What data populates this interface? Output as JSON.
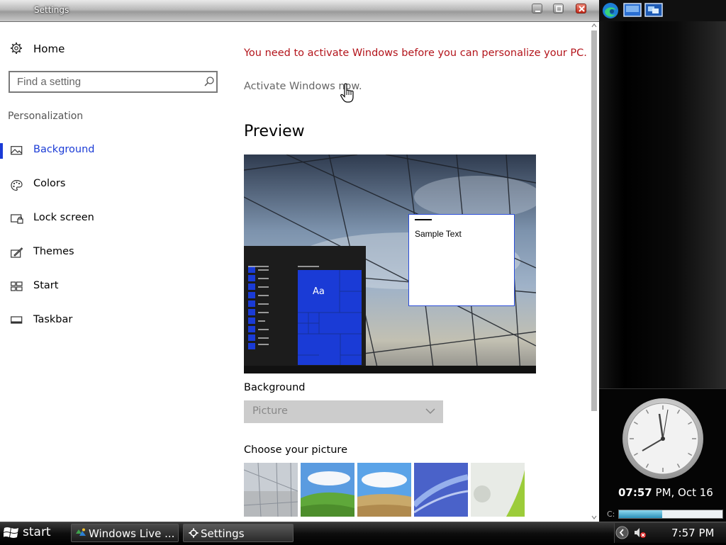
{
  "window": {
    "title": "Settings"
  },
  "nav": {
    "home_label": "Home",
    "search_placeholder": "Find a setting",
    "section_label": "Personalization",
    "items": [
      {
        "label": "Background",
        "icon": "picture-icon",
        "selected": true
      },
      {
        "label": "Colors",
        "icon": "palette-icon",
        "selected": false
      },
      {
        "label": "Lock screen",
        "icon": "lock-screen-icon",
        "selected": false
      },
      {
        "label": "Themes",
        "icon": "brush-icon",
        "selected": false
      },
      {
        "label": "Start",
        "icon": "start-grid-icon",
        "selected": false
      },
      {
        "label": "Taskbar",
        "icon": "taskbar-icon",
        "selected": false
      }
    ]
  },
  "main": {
    "activate_message": "You need to activate Windows before you can personalize your PC.",
    "activate_link": "Activate Windows now.",
    "preview_heading": "Preview",
    "preview_sample_text": "Sample Text",
    "preview_tile_text": "Aa",
    "background_label": "Background",
    "background_value": "Picture",
    "choose_picture_label": "Choose your picture"
  },
  "sidebar_gadgets": {
    "clock_time_bold": "07:57",
    "clock_time_rest": " PM, Oct 16",
    "drive_label": "C:",
    "drive_usage": 0.42
  },
  "taskbar": {
    "start_label": "start",
    "tasks": [
      {
        "label": "Windows Live ...",
        "icon": "windows-live-icon"
      },
      {
        "label": "Settings",
        "icon": "gear-icon"
      }
    ],
    "tray_time": "7:57 PM"
  },
  "colors": {
    "accent": "#1a3bd6",
    "warning_text": "#b3141b"
  }
}
